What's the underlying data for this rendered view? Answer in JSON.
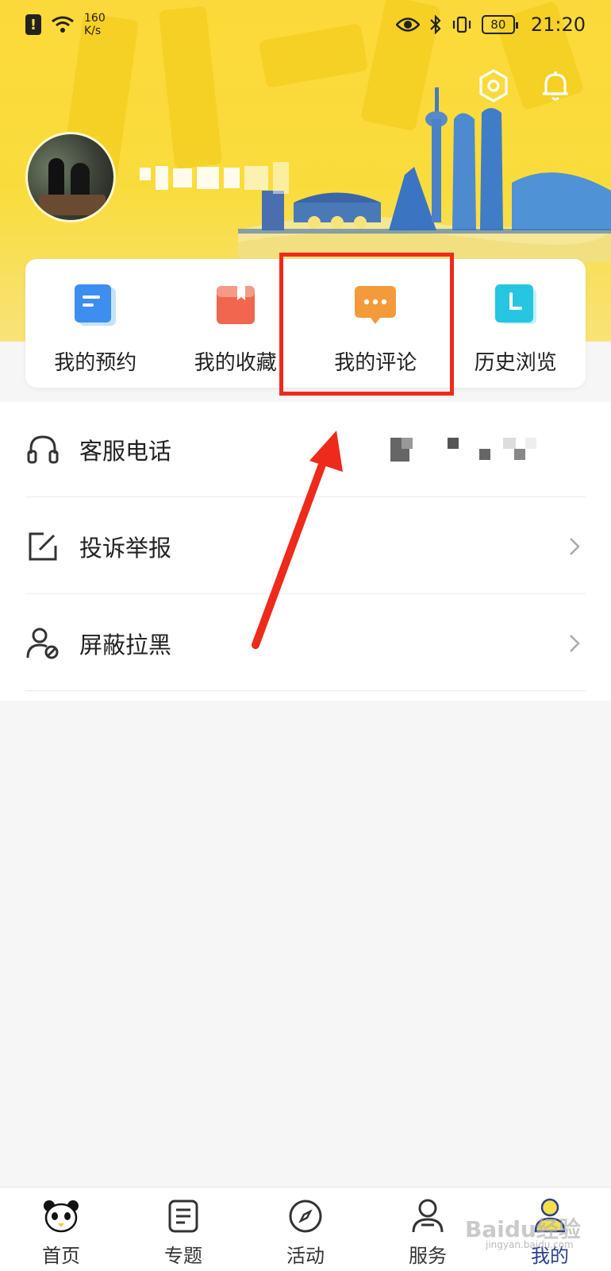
{
  "status_bar": {
    "net_speed_value": "160",
    "net_speed_unit": "K/s",
    "battery": "80",
    "time": "21:20"
  },
  "header": {
    "settings_icon": "gear-icon",
    "notification_icon": "bell-icon"
  },
  "quick_actions": [
    {
      "label": "我的预约",
      "icon": "appointment-icon",
      "color": "#3d8ef0"
    },
    {
      "label": "我的收藏",
      "icon": "favorites-icon",
      "color": "#f0664f"
    },
    {
      "label": "我的评论",
      "icon": "comment-icon",
      "color": "#f39a3a"
    },
    {
      "label": "历史浏览",
      "icon": "history-icon",
      "color": "#26c6e0"
    }
  ],
  "menu": {
    "customer_service": {
      "label": "客服电话",
      "icon": "headset-icon"
    },
    "complaint": {
      "label": "投诉举报",
      "icon": "edit-icon"
    },
    "block": {
      "label": "屏蔽拉黑",
      "icon": "user-block-icon"
    }
  },
  "bottom_nav": [
    {
      "label": "首页",
      "icon": "panda-icon"
    },
    {
      "label": "专题",
      "icon": "document-icon"
    },
    {
      "label": "活动",
      "icon": "compass-icon"
    },
    {
      "label": "服务",
      "icon": "user-icon"
    },
    {
      "label": "我的",
      "icon": "profile-icon",
      "active": true
    }
  ],
  "watermark": {
    "main": "Baidu经验",
    "sub": "jingyan.baidu.com"
  },
  "colors": {
    "header_yellow": "#fcd93a",
    "highlight_red": "#ee2a1b",
    "active_nav": "#2a3f8f"
  }
}
